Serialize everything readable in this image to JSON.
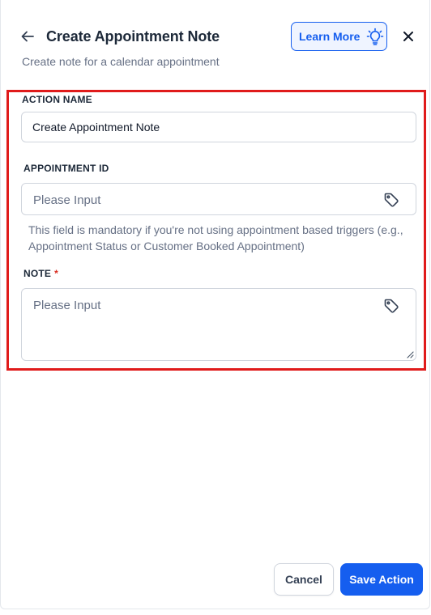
{
  "header": {
    "title": "Create Appointment Note",
    "subtitle": "Create note for a calendar appointment",
    "learn_more_label": "Learn More"
  },
  "form": {
    "action_name": {
      "label": "ACTION NAME",
      "value": "Create Appointment Note"
    },
    "appointment_id": {
      "label": "APPOINTMENT ID",
      "placeholder": "Please Input",
      "helper": "This field is mandatory if you're not using appointment based triggers (e.g., Appointment Status or Customer Booked Appointment)"
    },
    "note": {
      "label": "NOTE",
      "required_mark": "*",
      "placeholder": "Please Input"
    }
  },
  "footer": {
    "cancel_label": "Cancel",
    "save_label": "Save Action"
  },
  "colors": {
    "accent": "#155eef",
    "highlight": "#e01b1b",
    "required": "#d92d20"
  }
}
